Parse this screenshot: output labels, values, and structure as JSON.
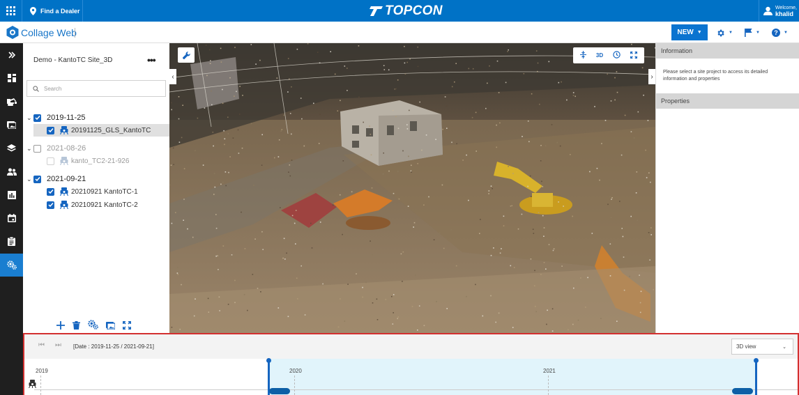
{
  "topbar": {
    "dealer_label": "Find a Dealer",
    "brand": "TOPCON",
    "welcome": "Welcome,",
    "username": "khalid"
  },
  "appbar": {
    "title": "Collage Web",
    "new_label": "NEW"
  },
  "nav": {
    "items": [
      "collapse",
      "dashboard",
      "machines",
      "media",
      "layers",
      "users",
      "reports",
      "calendar",
      "clipboard",
      "settings"
    ],
    "active": "settings"
  },
  "tree": {
    "project": "Demo - KantoTC Site_3D",
    "search_placeholder": "Search",
    "groups": [
      {
        "date": "2019-11-25",
        "checked": true,
        "dim": false,
        "items": [
          {
            "name": "20191125_GLS_KantoTC",
            "checked": true,
            "selected": true
          }
        ]
      },
      {
        "date": "2021-08-26",
        "checked": false,
        "dim": true,
        "items": [
          {
            "name": "kanto_TC2-21-926",
            "checked": false,
            "selected": false
          }
        ]
      },
      {
        "date": "2021-09-21",
        "checked": true,
        "dim": false,
        "items": [
          {
            "name": "20210921 KantoTC-1",
            "checked": true,
            "selected": false
          },
          {
            "name": "20210921 KantoTC-2",
            "checked": true,
            "selected": false
          }
        ]
      }
    ]
  },
  "viewport": {
    "mode_label": "3D"
  },
  "info": {
    "header": "Information",
    "message": "Please select a site project to access its detailed information and properties",
    "properties_header": "Properties"
  },
  "timeline": {
    "date_range": "[Date : 2019-11-25 / 2021-09-21]",
    "view_option": "3D view",
    "years": [
      "2019",
      "2020",
      "2021"
    ]
  },
  "colors": {
    "topbar": "#0072c6",
    "accent": "#1565c0",
    "nav_bg": "#1f1f1f",
    "nav_active": "#1a7ed0",
    "timeline_border": "#d32f2f",
    "range_fill": "#e1f4fb"
  }
}
